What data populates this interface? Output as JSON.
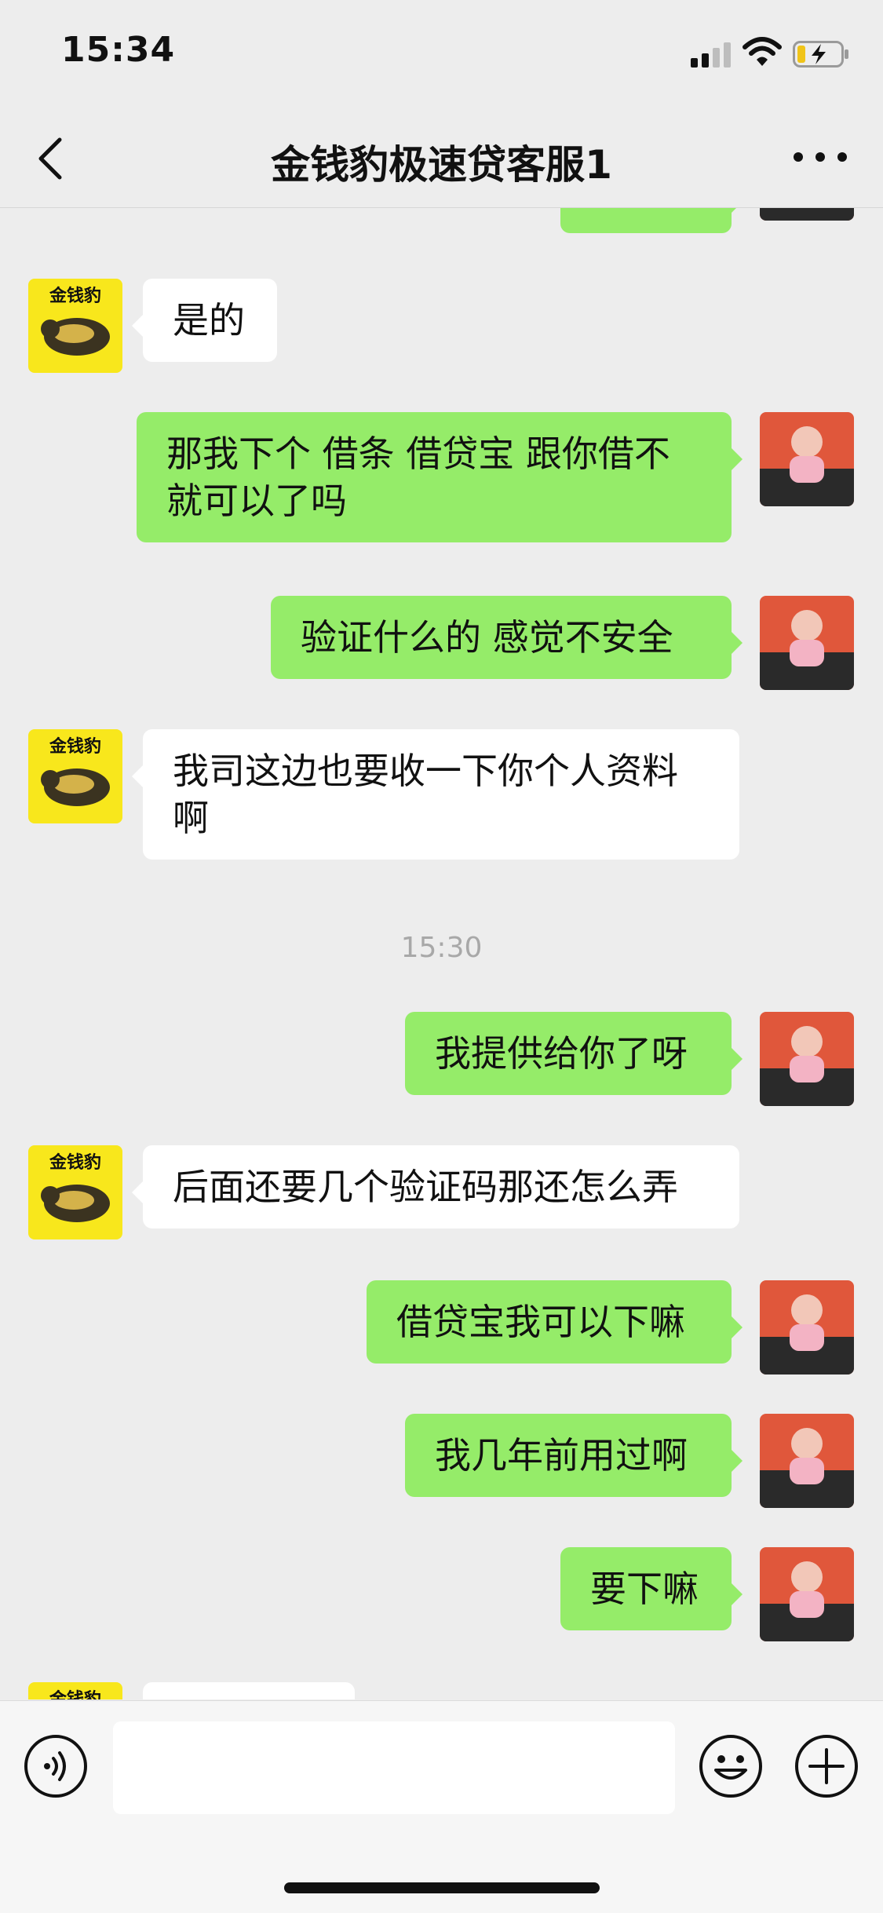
{
  "status_bar": {
    "time": "15:34",
    "icons": [
      "signal-icon",
      "wifi-icon",
      "battery-charging-icon"
    ]
  },
  "header": {
    "title": "金钱豹极速贷客服1",
    "back_icon": "chevron-left-icon",
    "more_icon": "more-dots-icon"
  },
  "contact": {
    "avatar_label": "金钱豹"
  },
  "colors": {
    "outgoing_bubble": "#95ec69",
    "incoming_bubble": "#ffffff",
    "background": "#ededed"
  },
  "messages": [
    {
      "side": "in",
      "text": "是的"
    },
    {
      "side": "out",
      "text": "那我下个 借条  借贷宝 跟你借不就可以了吗"
    },
    {
      "side": "out",
      "text": "验证什么的  感觉不安全"
    },
    {
      "side": "in",
      "text": "我司这边也要收一下你个人资料啊"
    },
    {
      "side": "time",
      "text": "15:30"
    },
    {
      "side": "out",
      "text": "我提供给你了呀"
    },
    {
      "side": "in",
      "text": "后面还要几个验证码那还怎么弄"
    },
    {
      "side": "out",
      "text": "借贷宝我可以下嘛"
    },
    {
      "side": "out",
      "text": "我几年前用过啊"
    },
    {
      "side": "out",
      "text": "要下嘛"
    }
  ],
  "input_bar": {
    "placeholder": "",
    "voice_icon": "voice-icon",
    "emoji_icon": "emoji-icon",
    "plus_icon": "plus-icon"
  }
}
